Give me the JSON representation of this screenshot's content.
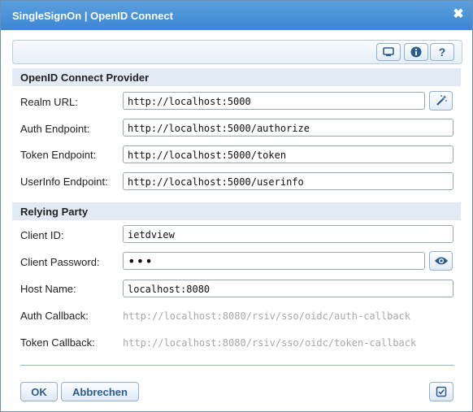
{
  "window": {
    "title": "SingleSignOn | OpenID Connect"
  },
  "sections": {
    "provider": "OpenID Connect Provider",
    "relying": "Relying Party"
  },
  "fields": {
    "realm_url": {
      "label": "Realm URL:",
      "value": "http://localhost:5000"
    },
    "auth_endpoint": {
      "label": "Auth Endpoint:",
      "value": "http://localhost:5000/authorize"
    },
    "token_endpoint": {
      "label": "Token Endpoint:",
      "value": "http://localhost:5000/token"
    },
    "userinfo_endpoint": {
      "label": "UserInfo Endpoint:",
      "value": "http://localhost:5000/userinfo"
    },
    "client_id": {
      "label": "Client ID:",
      "value": "ietdview"
    },
    "client_password": {
      "label": "Client Password:",
      "value": "•••"
    },
    "host_name": {
      "label": "Host Name:",
      "value": "localhost:8080"
    },
    "auth_callback": {
      "label": "Auth Callback:",
      "value": "http://localhost:8080/rsiv/sso/oidc/auth-callback"
    },
    "token_callback": {
      "label": "Token Callback:",
      "value": "http://localhost:8080/rsiv/sso/oidc/token-callback"
    }
  },
  "buttons": {
    "ok": "OK",
    "cancel": "Abbrechen"
  },
  "icons": {
    "toolbar": [
      "monitor-icon",
      "info-icon",
      "help-icon"
    ],
    "accent": "#3d86d0"
  }
}
